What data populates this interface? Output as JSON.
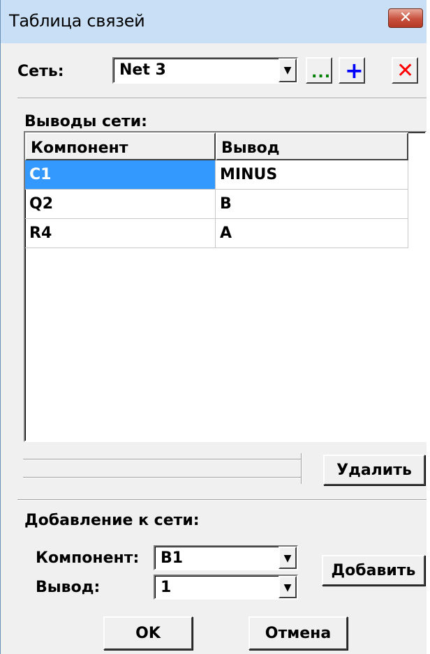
{
  "window": {
    "title": "Таблица связей",
    "close_glyph": "✕"
  },
  "net": {
    "label": "Сеть:",
    "value": "Net 3"
  },
  "toolbar": {
    "browse_label": "...",
    "add_glyph": "+",
    "delete_glyph": "✕"
  },
  "pins": {
    "label": "Выводы сети:",
    "columns": [
      "Компонент",
      "Вывод"
    ],
    "rows": [
      {
        "component": "C1",
        "pin": "MINUS",
        "selected": true
      },
      {
        "component": "Q2",
        "pin": "B",
        "selected": false
      },
      {
        "component": "R4",
        "pin": "A",
        "selected": false
      }
    ],
    "remove_label": "Удалить"
  },
  "add_section": {
    "label": "Добавление к сети:",
    "component_label": "Компонент:",
    "component_value": "B1",
    "pin_label": "Вывод:",
    "pin_value": "1",
    "add_label": "Добавить"
  },
  "footer": {
    "ok_label": "OK",
    "cancel_label": "Отмена"
  },
  "colors": {
    "selection": "#3399ff",
    "title_bar": "#c9dff5",
    "add_icon": "#0000ff",
    "delete_icon": "#ff0000",
    "browse_icon": "#008000"
  }
}
